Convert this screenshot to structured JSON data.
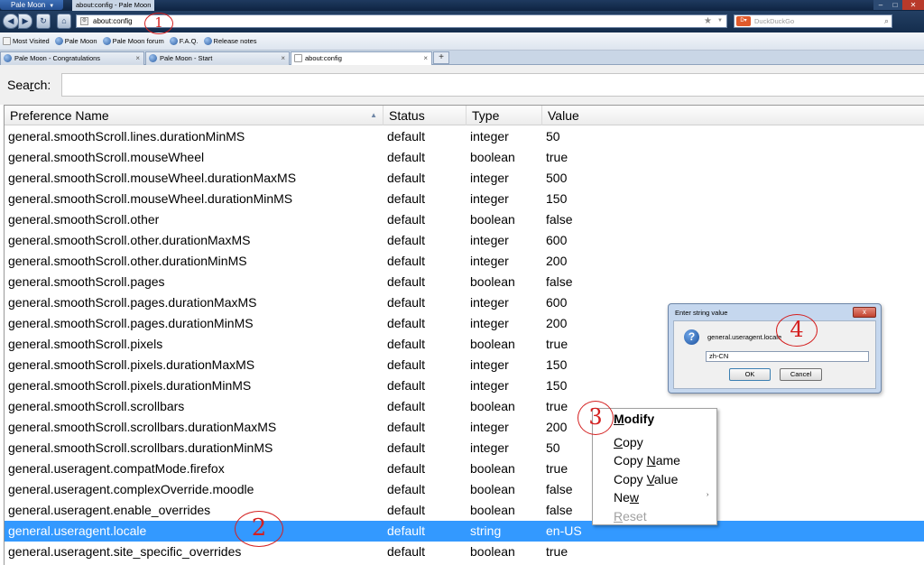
{
  "window": {
    "app_menu": "Pale Moon",
    "title": "about:config - Pale Moon"
  },
  "navbar": {
    "url": "about:config",
    "search_placeholder": "DuckDuckGo"
  },
  "bookmarks": [
    {
      "label": "Most Visited",
      "icon": "page-icon"
    },
    {
      "label": "Pale Moon",
      "icon": "pale-moon-icon"
    },
    {
      "label": "Pale Moon forum",
      "icon": "pale-moon-icon"
    },
    {
      "label": "F.A.Q.",
      "icon": "pale-moon-icon"
    },
    {
      "label": "Release notes",
      "icon": "pale-moon-icon"
    }
  ],
  "tabs": [
    {
      "label": "Pale Moon - Congratulations",
      "close": "×"
    },
    {
      "label": "Pale Moon - Start",
      "close": "×"
    },
    {
      "label": "about:config",
      "close": "×"
    }
  ],
  "newtab_label": "+",
  "search": {
    "label_pre": "Sea",
    "label_underline": "r",
    "label_post": "ch:",
    "value": ""
  },
  "columns": [
    "Preference Name",
    "Status",
    "Type",
    "Value"
  ],
  "rows": [
    [
      "general.smoothScroll.lines.durationMinMS",
      "default",
      "integer",
      "50"
    ],
    [
      "general.smoothScroll.mouseWheel",
      "default",
      "boolean",
      "true"
    ],
    [
      "general.smoothScroll.mouseWheel.durationMaxMS",
      "default",
      "integer",
      "500"
    ],
    [
      "general.smoothScroll.mouseWheel.durationMinMS",
      "default",
      "integer",
      "150"
    ],
    [
      "general.smoothScroll.other",
      "default",
      "boolean",
      "false"
    ],
    [
      "general.smoothScroll.other.durationMaxMS",
      "default",
      "integer",
      "600"
    ],
    [
      "general.smoothScroll.other.durationMinMS",
      "default",
      "integer",
      "200"
    ],
    [
      "general.smoothScroll.pages",
      "default",
      "boolean",
      "false"
    ],
    [
      "general.smoothScroll.pages.durationMaxMS",
      "default",
      "integer",
      "600"
    ],
    [
      "general.smoothScroll.pages.durationMinMS",
      "default",
      "integer",
      "200"
    ],
    [
      "general.smoothScroll.pixels",
      "default",
      "boolean",
      "true"
    ],
    [
      "general.smoothScroll.pixels.durationMaxMS",
      "default",
      "integer",
      "150"
    ],
    [
      "general.smoothScroll.pixels.durationMinMS",
      "default",
      "integer",
      "150"
    ],
    [
      "general.smoothScroll.scrollbars",
      "default",
      "boolean",
      "true"
    ],
    [
      "general.smoothScroll.scrollbars.durationMaxMS",
      "default",
      "integer",
      "200"
    ],
    [
      "general.smoothScroll.scrollbars.durationMinMS",
      "default",
      "integer",
      "50"
    ],
    [
      "general.useragent.compatMode.firefox",
      "default",
      "boolean",
      "true"
    ],
    [
      "general.useragent.complexOverride.moodle",
      "default",
      "boolean",
      "false"
    ],
    [
      "general.useragent.enable_overrides",
      "default",
      "boolean",
      "false"
    ],
    [
      "general.useragent.locale",
      "default",
      "string",
      "en-US"
    ],
    [
      "general.useragent.site_specific_overrides",
      "default",
      "boolean",
      "true"
    ]
  ],
  "selected_row": 19,
  "dialog": {
    "title": "Enter string value",
    "label": "general.useragent.locale",
    "value": "zh-CN",
    "ok": "OK",
    "cancel": "Cancel",
    "close": "x"
  },
  "context_menu": {
    "items": [
      {
        "pre": "",
        "u": "M",
        "post": "odify",
        "style": "bold"
      },
      {
        "pre": "",
        "u": "C",
        "post": "opy",
        "style": "normal"
      },
      {
        "pre": "Copy ",
        "u": "N",
        "post": "ame",
        "style": "normal"
      },
      {
        "pre": "Copy ",
        "u": "V",
        "post": "alue",
        "style": "normal"
      },
      {
        "pre": "Ne",
        "u": "w",
        "post": "",
        "style": "normal"
      },
      {
        "pre": "",
        "u": "R",
        "post": "eset",
        "style": "disabled"
      }
    ],
    "submenu_arrow": "›"
  },
  "annotations": [
    "1",
    "2",
    "3",
    "4"
  ],
  "colors": {
    "selection": "#3399ff",
    "annotation": "#d42020"
  }
}
